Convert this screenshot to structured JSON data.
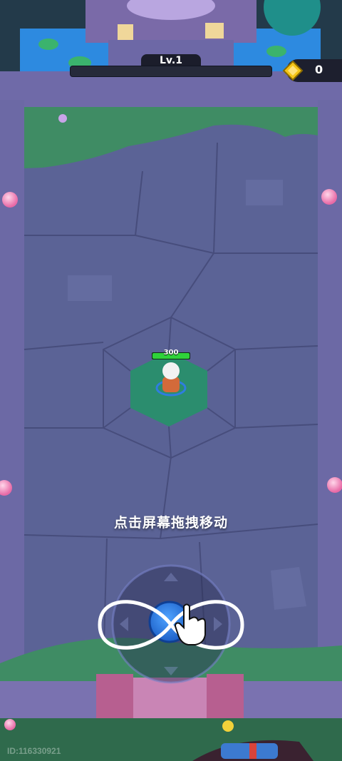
{
  "hud": {
    "level_label": "Lv.1",
    "level_progress": 0.0,
    "coin_icon": "coin-icon",
    "coin_count": "0"
  },
  "player": {
    "hp_value": "300",
    "hp_fraction": 1.0
  },
  "tutorial": {
    "hint_text": "点击屏幕拖拽移动",
    "gesture_icon": "infinity-gesture-icon",
    "hand_icon": "hand-pointer-icon"
  },
  "footer": {
    "player_id": "ID:116330921"
  },
  "colors": {
    "floor": "#5b6396",
    "wall": "#6f6aa8",
    "grass": "#3f8c64",
    "water": "#2d8ae0",
    "hp_green": "#2fd23a",
    "hex_pad": "#2b8d6e"
  }
}
